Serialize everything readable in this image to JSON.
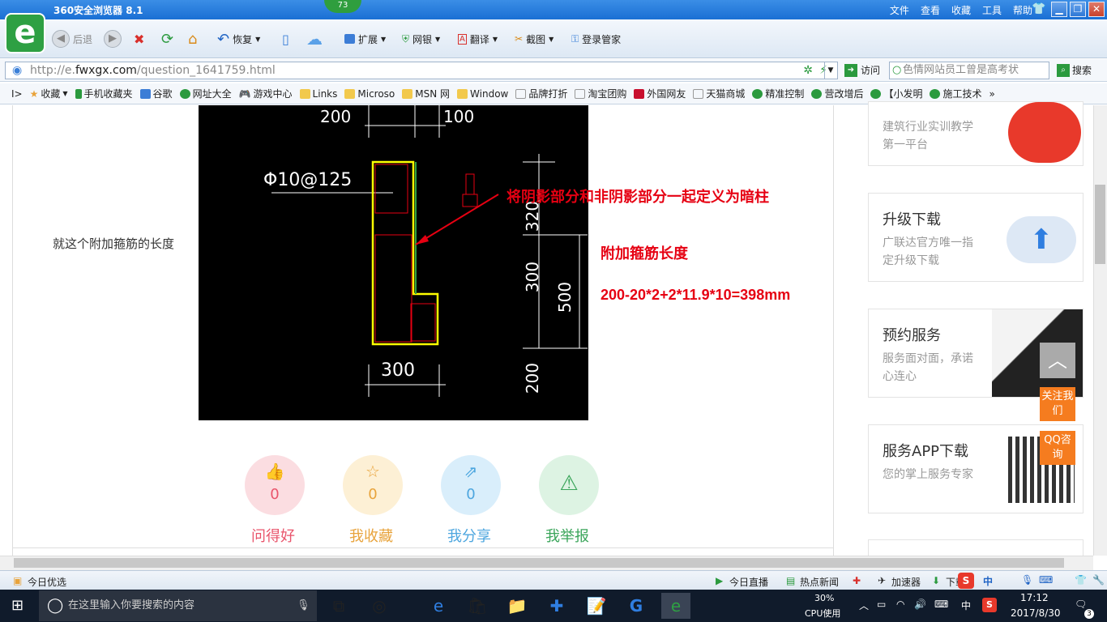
{
  "browser": {
    "title": "360安全浏览器 8.1",
    "badge": "73",
    "menu": [
      "文件",
      "查看",
      "收藏",
      "工具",
      "帮助"
    ],
    "window_controls": {
      "min": "▁",
      "restore": "❐",
      "close": "✕"
    }
  },
  "toolbar": {
    "back": "后退",
    "restore": "恢复",
    "extend": "扩展",
    "bank": "网银",
    "translate": "翻译",
    "screenshot": "截图",
    "login": "登录管家"
  },
  "address": {
    "url_prefix": "http://e.",
    "url_domain": "fwxgx.com",
    "url_path": "/question_1641759.html",
    "go_label": "访问",
    "search_value": "色情网站员工曾是高考状",
    "search_button": "搜索"
  },
  "favorites": [
    "收藏",
    "手机收藏夹",
    "谷歌",
    "网址大全",
    "游戏中心",
    "Links",
    "Microso",
    "MSN 网",
    "Window",
    "品牌打折",
    "淘宝团购",
    "外国网友",
    "天猫商城",
    "精准控制",
    "营改增后",
    "【小发明",
    "施工技术"
  ],
  "question": {
    "text": "就这个附加箍筋的长度"
  },
  "cad": {
    "dim_top_left": "200",
    "dim_top_right": "100",
    "rebar_label": "Φ10@125",
    "dim_320": "320",
    "dim_300_v": "300",
    "dim_500": "500",
    "dim_300_h": "300",
    "dim_200": "200"
  },
  "annotations": {
    "line1": "将阴影部分和非阴影部分一起定义为暗柱",
    "line2": "附加箍筋长度",
    "line3": "200-20*2+2*11.9*10=398mm"
  },
  "actions": [
    {
      "label": "问得好",
      "count": "0",
      "color": "#e9546b",
      "bg": "#fbdde1"
    },
    {
      "label": "我收藏",
      "count": "0",
      "color": "#e8a33b",
      "bg": "#fdf0d5"
    },
    {
      "label": "我分享",
      "count": "0",
      "color": "#4da6df",
      "bg": "#d9eefb"
    },
    {
      "label": "我举报",
      "count": "",
      "color": "#3aa55a",
      "bg": "#ddf3e3"
    }
  ],
  "sidebar": {
    "card0": {
      "desc": "建筑行业实训教学第一平台"
    },
    "card1": {
      "title": "升级下载",
      "desc": "广联达官方唯一指定升级下载"
    },
    "card2": {
      "title": "预约服务",
      "desc": "服务面对面，承诺心连心"
    },
    "card3": {
      "title": "服务APP下载",
      "desc": "您的掌上服务专家"
    }
  },
  "floating": {
    "top": "︿",
    "follow": "关注我们",
    "qq": "QQ咨询"
  },
  "statusbar": {
    "left": "今日优选",
    "live": "今日直播",
    "news": "热点新闻",
    "accelerator": "加速器",
    "download": "下载"
  },
  "taskbar": {
    "search_placeholder": "在这里输入你要搜索的内容",
    "cpu_percent": "30%",
    "cpu_label": "CPU使用",
    "ime": "中",
    "time": "17:12",
    "date": "2017/8/30",
    "notifications": "3"
  }
}
